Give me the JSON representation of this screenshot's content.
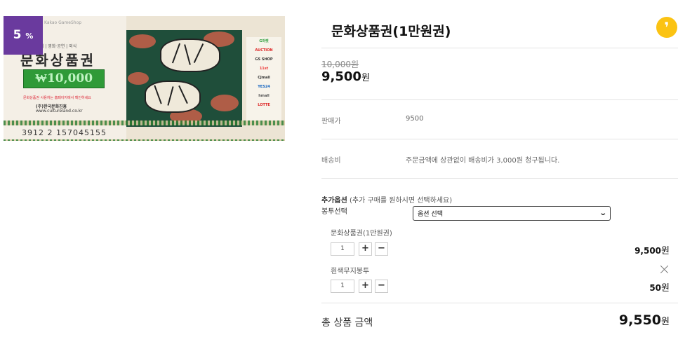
{
  "product": {
    "title": "문화상품권(1만원권)",
    "discount_value": "5",
    "discount_unit": "%",
    "price_original": "10,000원",
    "price_sale": "9,500",
    "currency_unit": "원"
  },
  "image": {
    "top_row": "Kakao GameShop",
    "menu": "온라인 | 도서 | 영화·공연 | 외식",
    "title": "문화상품권",
    "amount": "₩10,000",
    "note": "문화상품권 사용처는 홈페이지에서 확인하세요",
    "brand": "(주)한국문화진흥",
    "url": "www.cultureland.co.kr",
    "serial": "3912  2  157045155",
    "logos": [
      "G마켓",
      "AUCTION",
      "GS SHOP",
      "11st",
      "CJmall",
      "YES24",
      "hmall",
      "LOTTE"
    ]
  },
  "info": {
    "sale_price_label": "판매가",
    "sale_price_value": "9500",
    "shipping_label": "배송비",
    "shipping_value": "주문금액에 상관없이 배송비가 3,000원 청구됩니다."
  },
  "options": {
    "heading_bold": "추가옵션",
    "heading_note": "(추가 구매를 원하시면 선택하세요)",
    "envelope_label": "봉투선택",
    "select_value": "옵션 선택"
  },
  "selected_items": [
    {
      "name": "문화상품권(1만원권)",
      "qty": "1",
      "price": "9,500"
    },
    {
      "name": "흰색무지봉투",
      "qty": "1",
      "price": "50"
    }
  ],
  "controls": {
    "plus": "+",
    "minus": "−"
  },
  "total": {
    "label": "총 상품 금액",
    "amount": "9,550",
    "unit": "원"
  },
  "colors": {
    "badge": "#6a3a9e",
    "talk_button": "#fbc313",
    "voucher_green": "#2f9a38"
  },
  "icons": {
    "talk": "kakao-talk-icon",
    "remove": "close-icon",
    "dropdown": "chevron-down-icon"
  }
}
